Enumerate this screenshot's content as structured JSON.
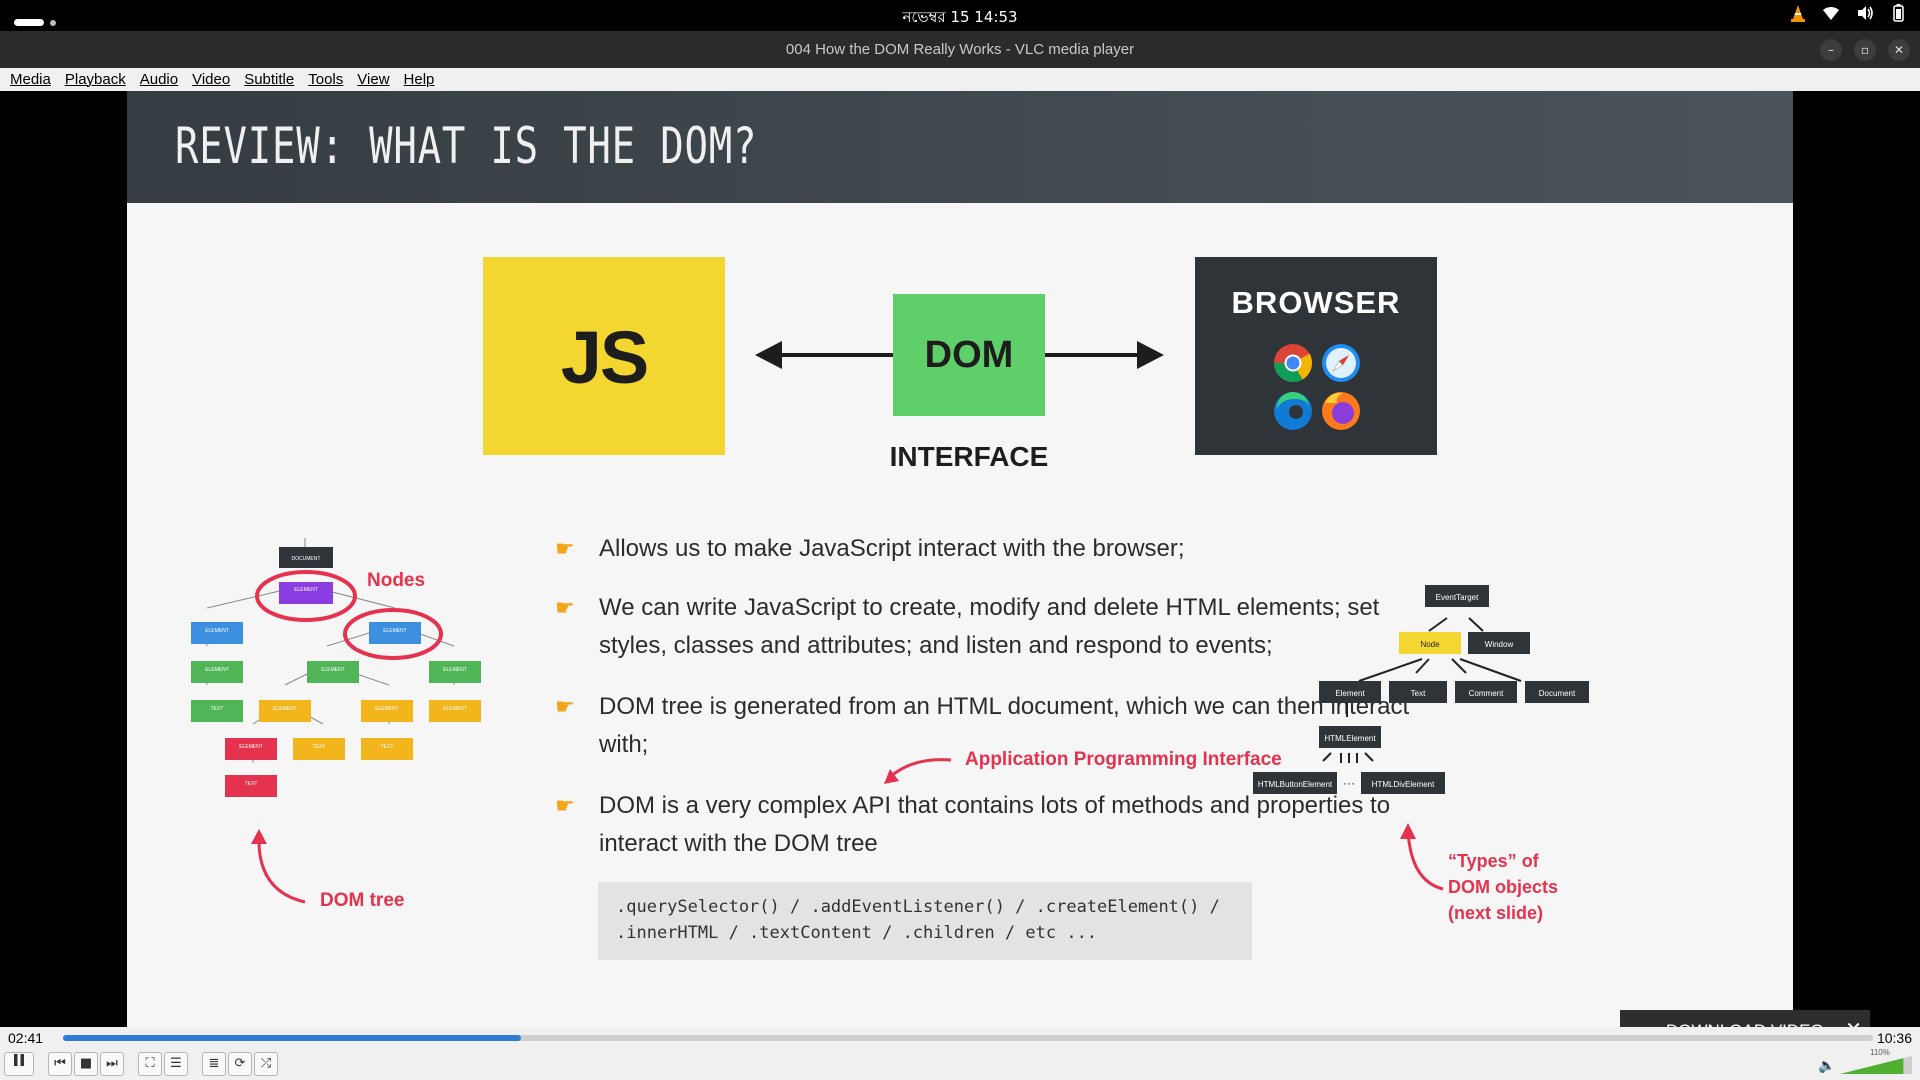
{
  "topbar": {
    "clock": "নভেম্বর 15  14:53",
    "icons": [
      "vlc-cone-icon",
      "wifi-icon",
      "volume-icon",
      "battery-icon"
    ]
  },
  "window": {
    "title": "004 How the DOM Really Works - VLC media player"
  },
  "menubar": {
    "items": [
      "Media",
      "Playback",
      "Audio",
      "Video",
      "Subtitle",
      "Tools",
      "View",
      "Help"
    ]
  },
  "slide": {
    "title": "REVIEW: WHAT IS THE DOM?",
    "js_label": "JS",
    "dom_label": "DOM",
    "browser_label": "BROWSER",
    "interface_label": "INTERFACE",
    "bullets": [
      "Allows us to make JavaScript interact with the browser;",
      "We can write JavaScript to create, modify and delete HTML elements; set styles, classes and attributes; and listen and respond to events;",
      "DOM tree is generated from an HTML document, which we can then interact with;",
      "DOM is a very complex API that contains lots of methods and properties to interact with the DOM tree"
    ],
    "api_label": "Application Programming Interface",
    "code_lines": [
      ".querySelector() / .addEventListener() / .createElement() /",
      ".innerHTML / .textContent / .children / etc ..."
    ],
    "nodes_label": "Nodes",
    "dom_tree_label": "DOM tree",
    "types_label_lines": [
      "“Types” of",
      "DOM objects",
      "(next slide)"
    ],
    "tree": {
      "root": "DOCUMENT",
      "element": "ELEMENT",
      "text": "TEXT"
    },
    "types_tree": {
      "event_target": "EventTarget",
      "node": "Node",
      "window": "Window",
      "element": "Element",
      "text": "Text",
      "comment": "Comment",
      "document": "Document",
      "html_element": "HTMLElement",
      "ellipsis": "···",
      "html_button": "HTMLButtonElement",
      "html_div": "HTMLDivElement"
    },
    "colors": {
      "js": "#f4d631",
      "dom": "#5fcf6a",
      "browser": "#2e3438",
      "accent_red": "#e5334f",
      "bullet_hand": "#f2a516"
    }
  },
  "overlay": {
    "download_label": "DOWNLOAD VIDEO",
    "close_icon": "close-icon"
  },
  "player": {
    "current_time": "02:41",
    "total_time": "10:36",
    "progress": 0.253,
    "volume_label": "110%",
    "volume_level": 1.1
  }
}
